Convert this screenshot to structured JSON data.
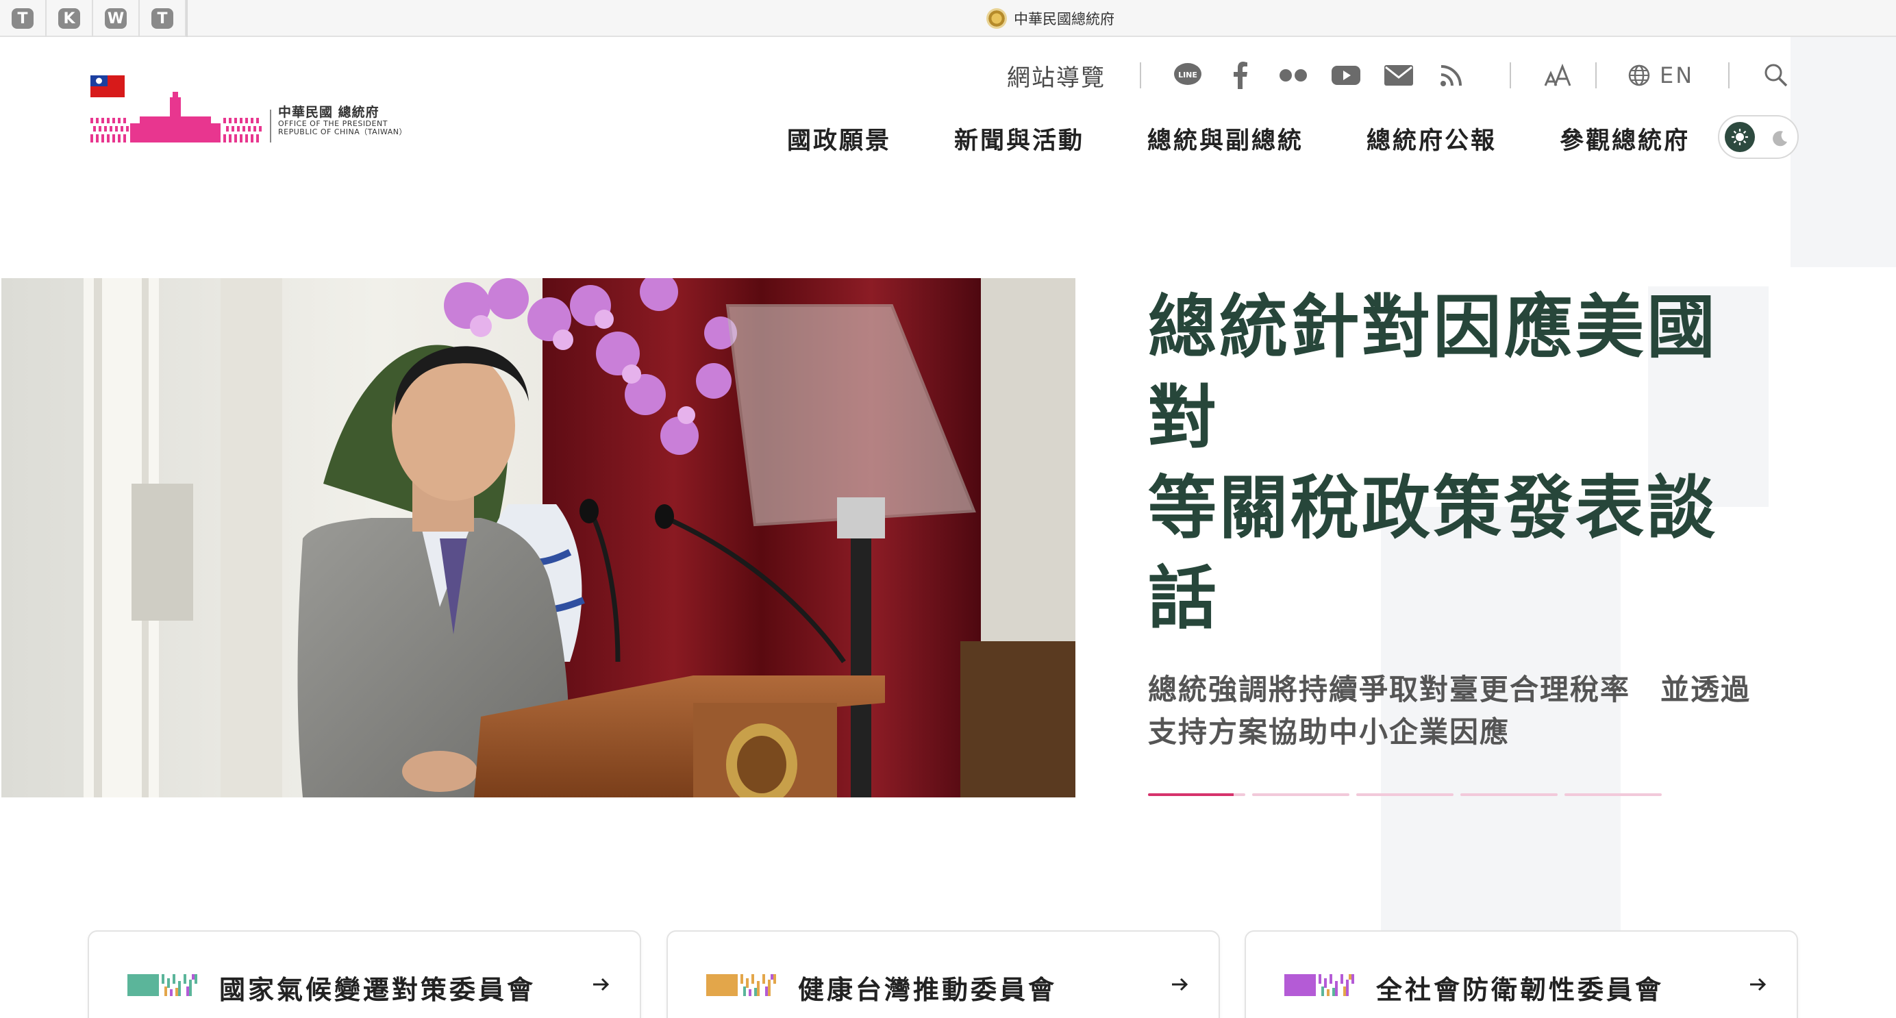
{
  "browser": {
    "pinned_tabs": [
      "T",
      "K",
      "W",
      "T"
    ],
    "active_tab_title": "中華民國總統府"
  },
  "logo": {
    "name_zh": "中華民國 總統府",
    "name_en_line1": "OFFICE OF THE PRESIDENT",
    "name_en_line2": "REPUBLIC OF CHINA（TAIWAN）",
    "brand_color": "#e8368f"
  },
  "utility": {
    "sitemap_label": "網站導覽",
    "social_icons": [
      "line-icon",
      "facebook-icon",
      "flickr-icon",
      "youtube-icon",
      "mail-icon",
      "rss-icon"
    ],
    "font_size_icon": "font-size-icon",
    "language_label": "EN",
    "search_icon": "search-icon"
  },
  "nav": {
    "items": [
      "國政願景",
      "新聞與活動",
      "總統與副總統",
      "總統府公報",
      "參觀總統府"
    ],
    "theme_toggle": {
      "light_icon": "sun-icon",
      "dark_icon": "moon-icon",
      "selected": "light"
    }
  },
  "hero": {
    "title_line1": "總統針對因應美國對",
    "title_line2": "等關稅政策發表談話",
    "subtitle_line1": "總統強調將持續爭取對臺更合理稅率　並透過",
    "subtitle_line2": "支持方案協助中小企業因應",
    "slides_total": 5,
    "slide_active": 1,
    "title_color": "#27463a",
    "accent_color": "#d6336c"
  },
  "cards": [
    {
      "label": "國家氣候變遷對策委員會",
      "mark_color": "#5bb59a",
      "arrow": "arrow-right-icon"
    },
    {
      "label": "健康台灣推動委員會",
      "mark_color": "#e3a64a",
      "arrow": "arrow-right-icon"
    },
    {
      "label": "全社會防衛韌性委員會",
      "mark_color": "#b45bd6",
      "arrow": "arrow-right-icon"
    }
  ]
}
